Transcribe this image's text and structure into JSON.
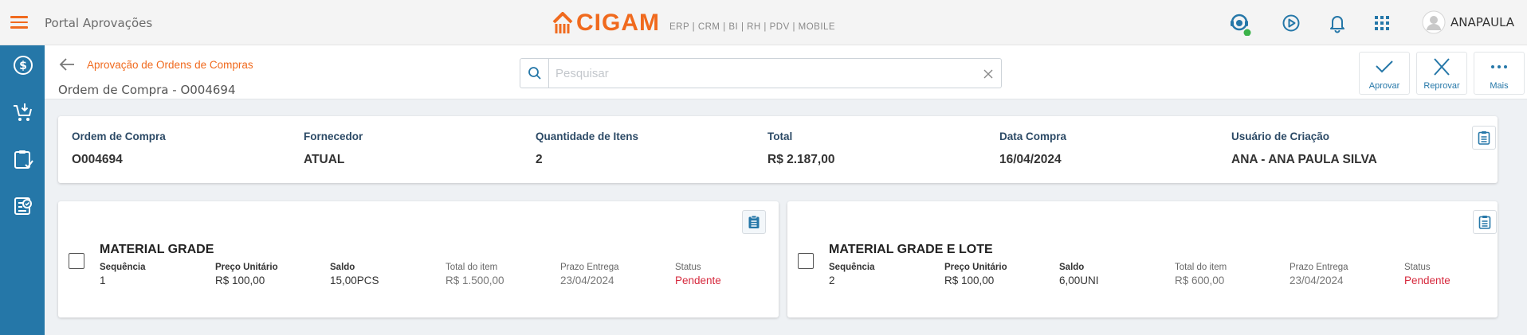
{
  "topbar": {
    "app_title": "Portal Aprovações",
    "logo_text": "CIGAM",
    "logo_sub": "ERP | CRM | BI | RH | PDV | MOBILE",
    "user_name": "ANAPAULA",
    "icons": [
      "menu-icon",
      "support-icon",
      "play-icon",
      "bell-icon",
      "apps-grid-icon",
      "user-avatar-icon"
    ]
  },
  "sidebar": {
    "icons": [
      "finance-icon",
      "cart-icon",
      "clipboard-icon",
      "approval-icon"
    ]
  },
  "header": {
    "breadcrumb": "Aprovação de Ordens de Compras",
    "subtitle": "Ordem de Compra - O004694",
    "search_placeholder": "Pesquisar",
    "actions": {
      "approve": "Aprovar",
      "reject": "Reprovar",
      "more": "Mais"
    }
  },
  "summary": {
    "columns": [
      {
        "label": "Ordem de Compra",
        "value": "O004694"
      },
      {
        "label": "Fornecedor",
        "value": "ATUAL"
      },
      {
        "label": "Quantidade de Itens",
        "value": "2"
      },
      {
        "label": "Total",
        "value": "R$ 2.187,00"
      },
      {
        "label": "Data Compra",
        "value": "16/04/2024"
      },
      {
        "label": "Usuário de Criação",
        "value": "ANA - ANA PAULA SILVA"
      }
    ]
  },
  "items": [
    {
      "title": "MATERIAL GRADE",
      "fields": [
        {
          "label": "Sequência",
          "value": "1"
        },
        {
          "label": "Preço Unitário",
          "value": "R$ 100,00"
        },
        {
          "label": "Saldo",
          "value": "15,00PCS"
        },
        {
          "label": "Total do item",
          "value": "R$ 1.500,00"
        },
        {
          "label": "Prazo Entrega",
          "value": "23/04/2024"
        },
        {
          "label": "Status",
          "value": "Pendente"
        }
      ]
    },
    {
      "title": "MATERIAL GRADE E LOTE",
      "fields": [
        {
          "label": "Sequência",
          "value": "2"
        },
        {
          "label": "Preço Unitário",
          "value": "R$ 100,00"
        },
        {
          "label": "Saldo",
          "value": "6,00UNI"
        },
        {
          "label": "Total do item",
          "value": "R$ 600,00"
        },
        {
          "label": "Prazo Entrega",
          "value": "23/04/2024"
        },
        {
          "label": "Status",
          "value": "Pendente"
        }
      ]
    }
  ],
  "colors": {
    "accent": "#f06a1e",
    "sidebar": "#2577a8",
    "status_pending": "#d6293d",
    "online": "#3cb34a"
  }
}
